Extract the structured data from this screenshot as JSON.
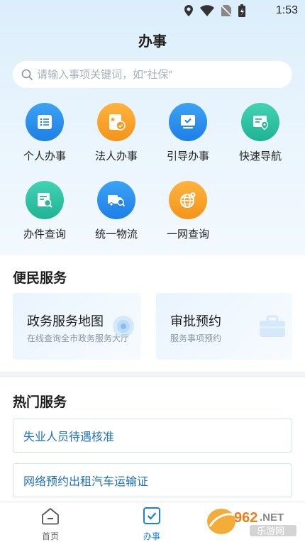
{
  "status": {
    "time": "1:53"
  },
  "header": {
    "title": "办事"
  },
  "search": {
    "placeholder": "请输入事项关键词，如\"社保\""
  },
  "quick_actions": [
    {
      "label": "个人办事",
      "icon": "list-icon",
      "color": "#1f84e8"
    },
    {
      "label": "法人办事",
      "icon": "certificate-icon",
      "color": "#f59a1f"
    },
    {
      "label": "引导办事",
      "icon": "monitor-check-icon",
      "color": "#1f84e8"
    },
    {
      "label": "快速导航",
      "icon": "map-pin-icon",
      "color": "#22b899"
    },
    {
      "label": "办件查询",
      "icon": "document-search-icon",
      "color": "#22b899"
    },
    {
      "label": "统一物流",
      "icon": "truck-search-icon",
      "color": "#1f84e8"
    },
    {
      "label": "一网查询",
      "icon": "globe-pin-icon",
      "color": "#f59a1f"
    }
  ],
  "convenience": {
    "title": "便民服务",
    "cards": [
      {
        "title": "政务服务地图",
        "subtitle": "在线查询全市政务服务大厅",
        "icon": "map-marker-icon"
      },
      {
        "title": "审批预约",
        "subtitle": "服务事项预约",
        "icon": "briefcase-icon"
      }
    ]
  },
  "hot": {
    "title": "热门服务",
    "items": [
      {
        "label": "失业人员待遇核准"
      },
      {
        "label": "网络预约出租汽车运输证"
      }
    ]
  },
  "tabbar": {
    "items": [
      {
        "label": "首页",
        "icon": "home-icon",
        "active": false
      },
      {
        "label": "办事",
        "icon": "checkbox-icon",
        "active": true
      }
    ]
  },
  "watermark": {
    "number": "962",
    "suffix": ".NET",
    "text": "乐游网"
  }
}
